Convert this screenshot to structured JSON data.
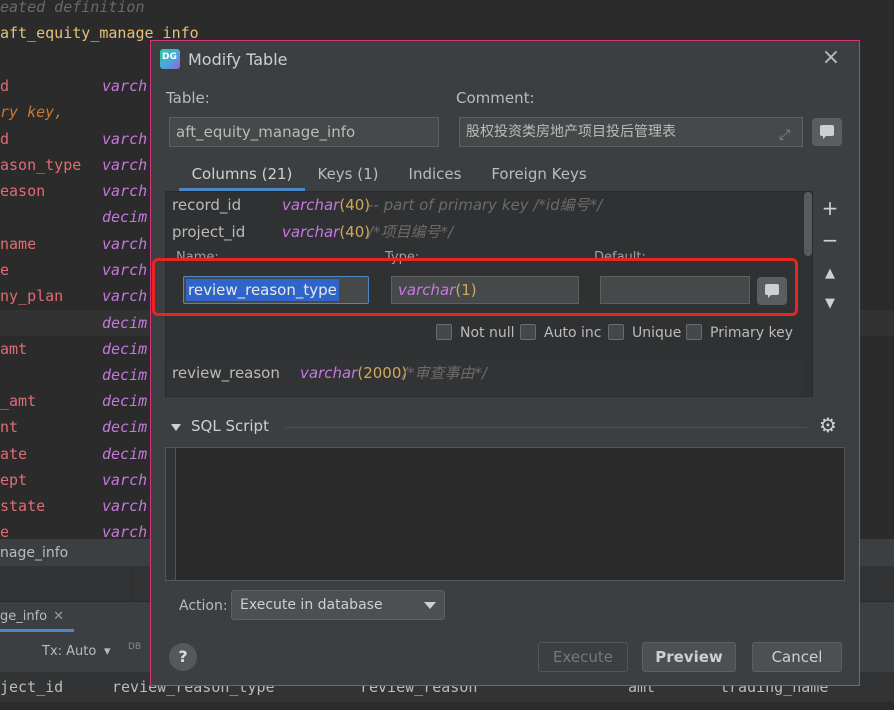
{
  "editor": {
    "comment_line": "eated definition",
    "table_line": "aft_equity_manage_info",
    "pk_line": "ry key,",
    "lines": [
      {
        "name": "d",
        "type": "varch"
      },
      {
        "name": "d",
        "type": "varch"
      },
      {
        "name": "ason_type",
        "type": "varch"
      },
      {
        "name": "eason",
        "type": "varch"
      },
      {
        "name": "",
        "type": "decim"
      },
      {
        "name": "name",
        "type": "varch"
      },
      {
        "name": "e",
        "type": "varch"
      },
      {
        "name": "ny_plan",
        "type": "varch"
      },
      {
        "name": "",
        "type": "decim"
      },
      {
        "name": "amt",
        "type": "decim"
      },
      {
        "name": "",
        "type": "decim"
      },
      {
        "name": "_amt",
        "type": "decim"
      },
      {
        "name": "nt",
        "type": "decim"
      },
      {
        "name": "ate",
        "type": "decim"
      },
      {
        "name": "ept",
        "type": "varch"
      },
      {
        "name": "state",
        "type": "varch"
      },
      {
        "name": "e",
        "type": "varch"
      }
    ]
  },
  "structure_bar": {
    "label": "nage_info"
  },
  "results": {
    "tab_label": "ge_info",
    "tx_label": "Tx: Auto",
    "db_label": "DB",
    "columns": [
      "ject_id",
      "review_reason_type",
      "review_reason",
      "amt",
      "trading_name"
    ]
  },
  "dialog": {
    "title": "Modify Table",
    "table_label": "Table:",
    "table_value": "aft_equity_manage_info",
    "comment_label": "Comment:",
    "comment_value": "股权投资类房地产项目投后管理表",
    "tabs": [
      "Columns (21)",
      "Keys (1)",
      "Indices",
      "Foreign Keys"
    ],
    "columns_list": [
      {
        "name": "record_id",
        "type": "varchar",
        "len": "(40)",
        "comment": "-- part of primary key /*id编号*/"
      },
      {
        "name": "project_id",
        "type": "varchar",
        "len": "(40)",
        "comment": "/*项目编号*/"
      },
      {
        "name": "review_reason",
        "type": "varchar",
        "len": "(2000)",
        "comment": "/*审查事由*/"
      },
      {
        "name": "",
        "type": "",
        "len": "",
        "comment": ""
      }
    ],
    "editor": {
      "name_label": "Name:",
      "type_label": "Type:",
      "default_label": "Default:",
      "name_value": "review_reason_type",
      "type_value": "varchar",
      "type_len": "(1)",
      "default_value": ""
    },
    "checkboxes": [
      "Not null",
      "Auto inc",
      "Unique",
      "Primary key"
    ],
    "sql_script_label": "SQL Script",
    "action_label": "Action:",
    "action_value": "Execute in database",
    "buttons": {
      "execute": "Execute",
      "preview": "Preview",
      "cancel": "Cancel",
      "help": "?"
    }
  },
  "colors": {
    "accent": "#4a88c7",
    "highlight_border": "#e8261f",
    "dialog_border": "#d6337a",
    "type_purple": "#c678dd"
  }
}
